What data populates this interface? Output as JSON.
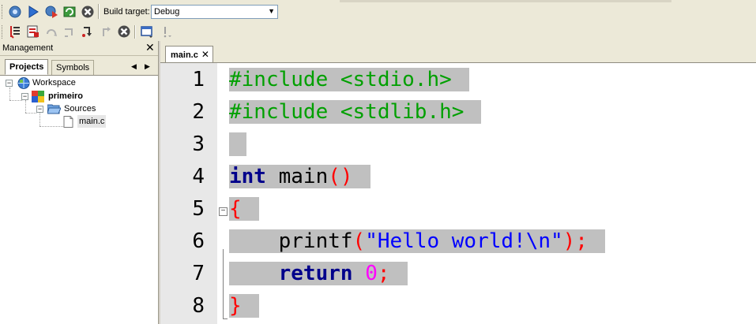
{
  "toolbar": {
    "build_target_label": "Build target:",
    "build_target_value": "Debug"
  },
  "management": {
    "title": "Management",
    "tabs": [
      {
        "label": "Projects"
      },
      {
        "label": "Symbols"
      }
    ],
    "tree": {
      "workspace": "Workspace",
      "project": "primeiro",
      "folder": "Sources",
      "file": "main.c"
    }
  },
  "editor": {
    "tab_label": "main.c",
    "lines": [
      {
        "n": "1",
        "tokens": [
          {
            "t": "#include <stdio.h>",
            "c": "pp"
          }
        ]
      },
      {
        "n": "2",
        "tokens": [
          {
            "t": "#include <stdlib.h>",
            "c": "pp"
          }
        ]
      },
      {
        "n": "3",
        "tokens": [
          {
            "t": "",
            "c": "plain"
          }
        ]
      },
      {
        "n": "4",
        "tokens": [
          {
            "t": "int",
            "c": "kw"
          },
          {
            "t": " main",
            "c": "plain"
          },
          {
            "t": "()",
            "c": "op"
          }
        ]
      },
      {
        "n": "5",
        "tokens": [
          {
            "t": "{",
            "c": "op"
          }
        ]
      },
      {
        "n": "6",
        "tokens": [
          {
            "t": "    printf",
            "c": "plain"
          },
          {
            "t": "(",
            "c": "op"
          },
          {
            "t": "\"Hello world!\\n\"",
            "c": "str"
          },
          {
            "t": ");",
            "c": "op"
          }
        ]
      },
      {
        "n": "7",
        "tokens": [
          {
            "t": "    ",
            "c": "plain"
          },
          {
            "t": "return",
            "c": "kw"
          },
          {
            "t": " ",
            "c": "plain"
          },
          {
            "t": "0",
            "c": "num"
          },
          {
            "t": ";",
            "c": "op"
          }
        ]
      },
      {
        "n": "8",
        "tokens": [
          {
            "t": "}",
            "c": "op"
          }
        ]
      }
    ]
  }
}
